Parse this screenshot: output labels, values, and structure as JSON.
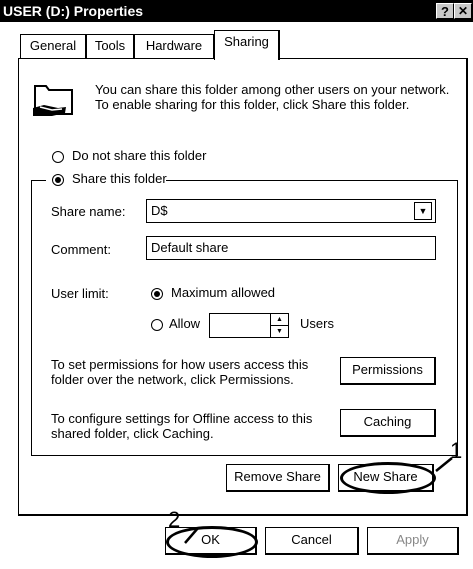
{
  "window": {
    "title": "USER (D:) Properties",
    "help_btn": "?",
    "close_btn": "✕"
  },
  "tabs": [
    {
      "label": "General",
      "active": false
    },
    {
      "label": "Tools",
      "active": false
    },
    {
      "label": "Hardware",
      "active": false
    },
    {
      "label": "Sharing",
      "active": true
    }
  ],
  "sharing": {
    "intro": "You can share this folder among other users on your network.  To enable sharing for this folder, click Share this folder.",
    "do_not_share": "Do not share this folder",
    "share_this": "Share this folder",
    "share_name_label": "Share name:",
    "share_name_value": "D$",
    "comment_label": "Comment:",
    "comment_value": "Default share",
    "user_limit_label": "User limit:",
    "max_allowed": "Maximum allowed",
    "allow": "Allow",
    "users": "Users",
    "permissions_text": "To set permissions for how users access this folder over the network, click Permissions.",
    "permissions_btn": "Permissions",
    "caching_text": "To configure settings for Offline access to this shared folder, click Caching.",
    "caching_btn": "Caching",
    "remove_share_btn": "Remove Share",
    "new_share_btn": "New Share"
  },
  "footer": {
    "ok": "OK",
    "cancel": "Cancel",
    "apply": "Apply"
  },
  "annotations": {
    "one": "1",
    "two": "2"
  }
}
